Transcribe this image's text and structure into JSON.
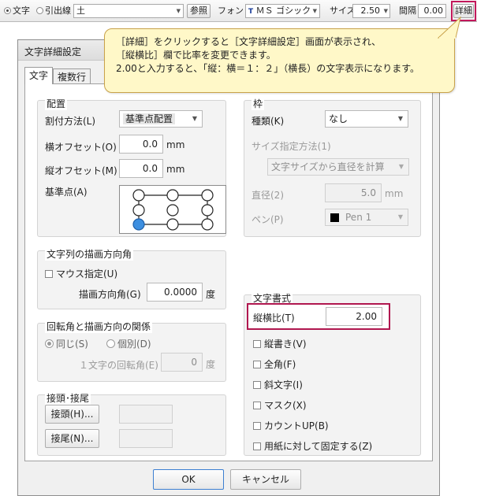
{
  "toolbar": {
    "mode_text": "文字",
    "mode_leader": "引出線",
    "text_value": "土",
    "ref_button": "参照",
    "font_label": "フォント",
    "font_value": "ＭＳ ゴシック",
    "font_badge": "T",
    "size_label": "サイズ",
    "size_value": "2.50",
    "spacing_label": "間隔",
    "spacing_value": "0.00",
    "detail_button": "詳細"
  },
  "callout": {
    "line1": "［詳細］をクリックすると［文字詳細設定］画面が表示され、",
    "line2": "［縦横比］欄で比率を変更できます。",
    "line3": "2.00と入力すると、｢縦：横＝１：２｣（横長）の文字表示になります。"
  },
  "dialog": {
    "title": "文字詳細設定",
    "tabs": [
      "文字",
      "複数行"
    ],
    "layout": {
      "legend": "配置",
      "method_label": "割付方法(L)",
      "method_value": "基準点配置",
      "x_offset_label": "横オフセット(O)",
      "x_offset_value": "0.0",
      "y_offset_label": "縦オフセット(M)",
      "y_offset_value": "0.0",
      "unit": "mm",
      "base_point_label": "基準点(A)"
    },
    "frame": {
      "legend": "枠",
      "type_label": "種類(K)",
      "type_value": "なし",
      "size_method_label": "サイズ指定方法(1)",
      "size_method_value": "文字サイズから直径を計算",
      "diameter_label": "直径(2)",
      "diameter_value": "5.0",
      "unit": "mm",
      "pen_label": "ペン(P)",
      "pen_value": "Pen 1"
    },
    "direction": {
      "legend": "文字列の描画方向角",
      "mouse_label": "マウス指定(U)",
      "angle_label": "描画方向角(G)",
      "angle_value": "0.0000",
      "unit": "度"
    },
    "rotation": {
      "legend": "回転角と描画方向の関係",
      "same_label": "同じ(S)",
      "separate_label": "個別(D)",
      "char_angle_label": "１文字の回転角(E)",
      "char_angle_value": "0",
      "unit": "度"
    },
    "prefix_suffix": {
      "legend": "接頭･接尾",
      "prefix_button": "接頭(H)...",
      "suffix_button": "接尾(N)..."
    },
    "format": {
      "legend": "文字書式",
      "ratio_label": "縦横比(T)",
      "ratio_value": "2.00",
      "options": [
        "縦書き(V)",
        "全角(F)",
        "斜文字(I)",
        "マスク(X)",
        "カウントUP(B)",
        "用紙に対して固定する(Z)"
      ]
    },
    "ok_button": "OK",
    "cancel_button": "キャンセル"
  },
  "colors": {
    "highlight": "#b0174f",
    "callout_fill": "#fff8c8",
    "base_point_selected": "#3d8fe0"
  }
}
